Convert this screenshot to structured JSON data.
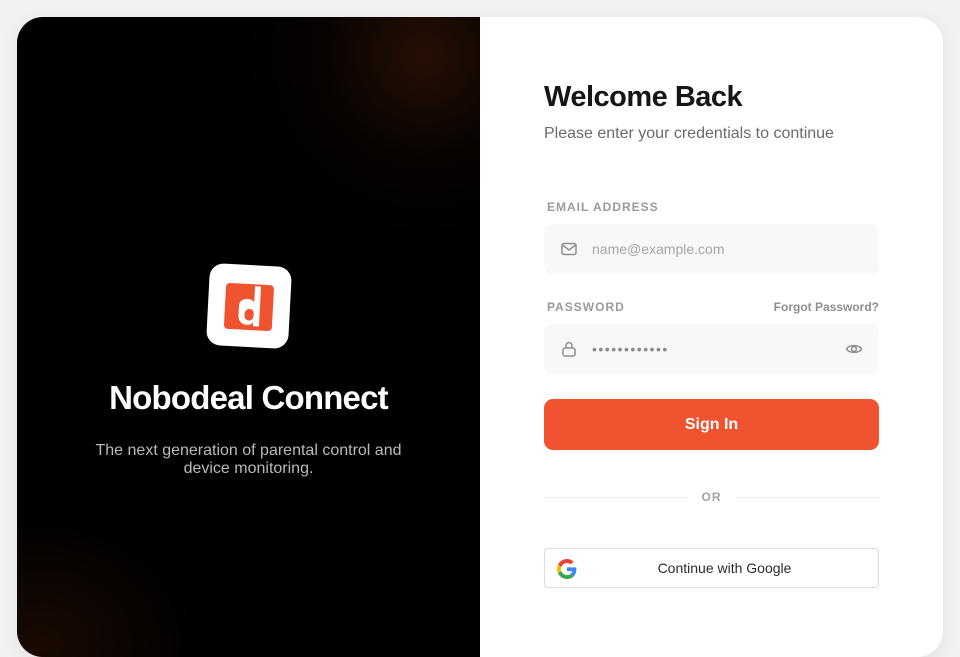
{
  "brand": {
    "name": "Nobodeal Connect",
    "tagline": "The next generation of parental control and device monitoring.",
    "logo_icon": "nobodeal-logo-icon",
    "accent": "#f0532f"
  },
  "login": {
    "title": "Welcome Back",
    "subtitle": "Please enter your credentials to continue",
    "email": {
      "label": "EMAIL ADDRESS",
      "placeholder": "name@example.com",
      "value": "",
      "icon": "mail-icon"
    },
    "password": {
      "label": "PASSWORD",
      "masked_value": "••••••••••••",
      "icon": "lock-icon",
      "toggle_icon": "eye-icon"
    },
    "forgot_label": "Forgot Password?",
    "signin_label": "Sign In",
    "divider_label": "OR",
    "google_label": "Continue with Google",
    "google_icon": "google-icon"
  }
}
